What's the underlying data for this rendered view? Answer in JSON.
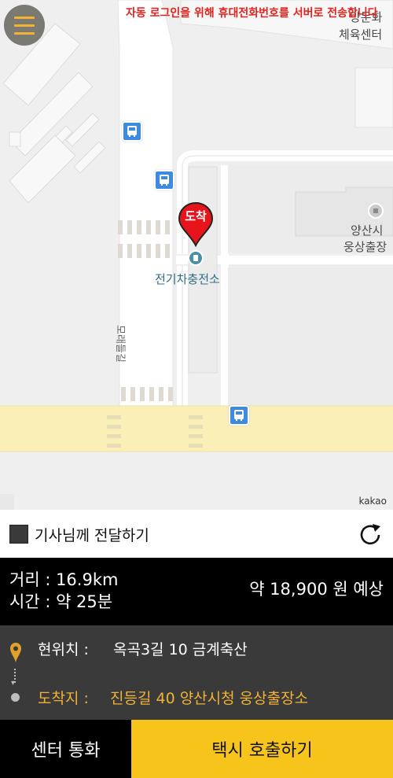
{
  "map": {
    "notice": "자동 로그인을 위해 휴대전화번호를 서버로 전송합니다",
    "top_right_label_1": "양문화",
    "top_right_label_2": "체육센터",
    "road_label": "모래들길",
    "poi_charger": "전기차충전소",
    "poi_office_1": "양산시",
    "poi_office_2": "웅상출장",
    "arrival_pin": "도착",
    "attribution": "kakao",
    "icons": {
      "menu": "hamburger-menu-icon",
      "bus_stop": "bus-stop-icon",
      "pin": "destination-pin-icon",
      "charger": "ev-charger-icon"
    }
  },
  "message": {
    "label": "기사님께 전달하기",
    "refresh_icon": "refresh-icon"
  },
  "trip": {
    "distance": "거리 : 16.9km",
    "time": "시간 : 약 25분",
    "fare": "약 18,900 원 예상"
  },
  "route": {
    "current_key": "현위치 :",
    "current_value": "옥곡3길 10 금계축산",
    "destination_key": "도착지 :",
    "destination_value": "진등길 40 양산시청 웅상출장소"
  },
  "buttons": {
    "center_call": "센터 통화",
    "taxi_call": "택시 호출하기"
  },
  "colors": {
    "accent_yellow": "#f7c41b",
    "notice_red": "#e3221e",
    "pin_red": "#e8141c",
    "dark_panel": "#3a3a3a"
  }
}
